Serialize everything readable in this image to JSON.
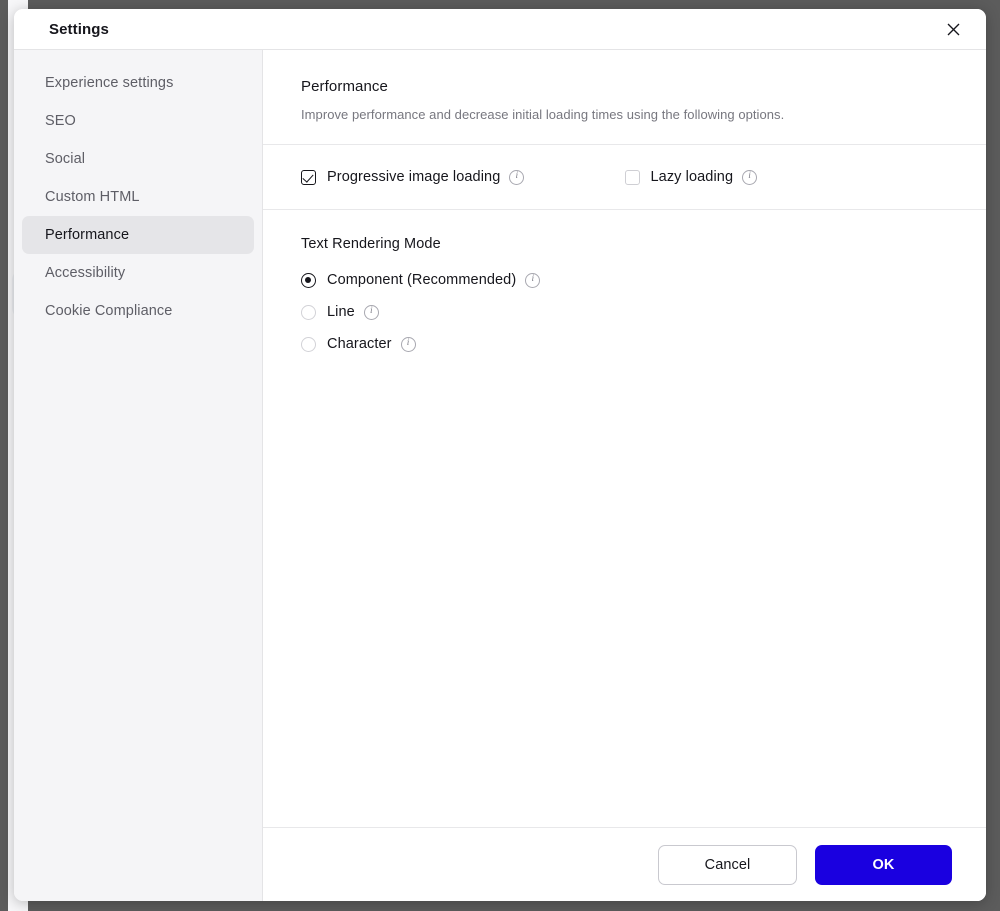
{
  "dialog": {
    "title": "Settings",
    "close_icon": "close-icon"
  },
  "sidebar": {
    "items": [
      {
        "label": "Experience settings",
        "active": false
      },
      {
        "label": "SEO",
        "active": false
      },
      {
        "label": "Social",
        "active": false
      },
      {
        "label": "Custom HTML",
        "active": false
      },
      {
        "label": "Performance",
        "active": true
      },
      {
        "label": "Accessibility",
        "active": false
      },
      {
        "label": "Cookie Compliance",
        "active": false
      }
    ]
  },
  "content": {
    "heading": "Performance",
    "description": "Improve performance and decrease initial loading times using the following options.",
    "checkboxes": [
      {
        "label": "Progressive image loading",
        "checked": true,
        "info_icon": "info-icon"
      },
      {
        "label": "Lazy loading",
        "checked": false,
        "info_icon": "info-icon"
      }
    ],
    "radio_group": {
      "title": "Text Rendering Mode",
      "options": [
        {
          "label": "Component (Recommended)",
          "selected": true,
          "info_icon": "info-icon"
        },
        {
          "label": "Line",
          "selected": false,
          "info_icon": "info-icon"
        },
        {
          "label": "Character",
          "selected": false,
          "info_icon": "info-icon"
        }
      ]
    }
  },
  "footer": {
    "cancel_label": "Cancel",
    "ok_label": "OK"
  },
  "colors": {
    "primary": "#1a00e0",
    "sidebar_bg": "#f5f5f7",
    "sidebar_active_bg": "#e5e5e8",
    "backdrop": "#5c5c5c",
    "selection_blue": "#3b5a8c"
  },
  "info_glyph": "i"
}
